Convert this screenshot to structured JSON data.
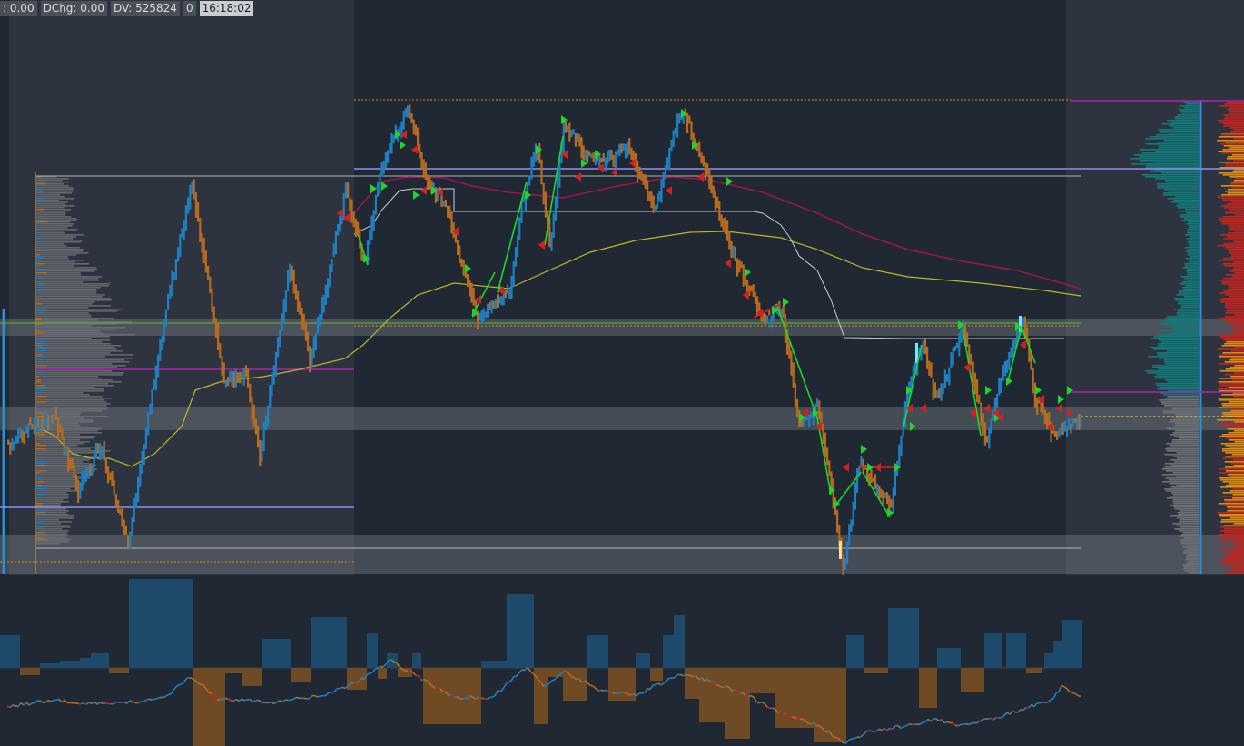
{
  "header": {
    "chg_text": ": 0.00",
    "dchg_text": "DChg: 0.00",
    "dv_text": "DV: 525824",
    "count_text": "0",
    "time_text": "16:18:02"
  },
  "colors": {
    "background": "#1f2833",
    "up_bar": "#1f7fbf",
    "down_bar": "#b86a1e",
    "profile_teal": "#127a7a",
    "profile_grey": "#6d7075",
    "profile_orange": "#e38a0b",
    "profile_red": "#c0261f",
    "vwap_magenta": "#a0154f",
    "ma_yellow": "#b8b828",
    "stair_white": "#c8ccd0",
    "signal_green": "#1fd42a",
    "signal_red": "#d42020",
    "level_violet": "#8f8ff0",
    "level_magenta": "#b01fb0"
  },
  "icons": {
    "buy_marker": "green-triangle-icon",
    "sell_marker": "red-triangle-icon"
  }
}
